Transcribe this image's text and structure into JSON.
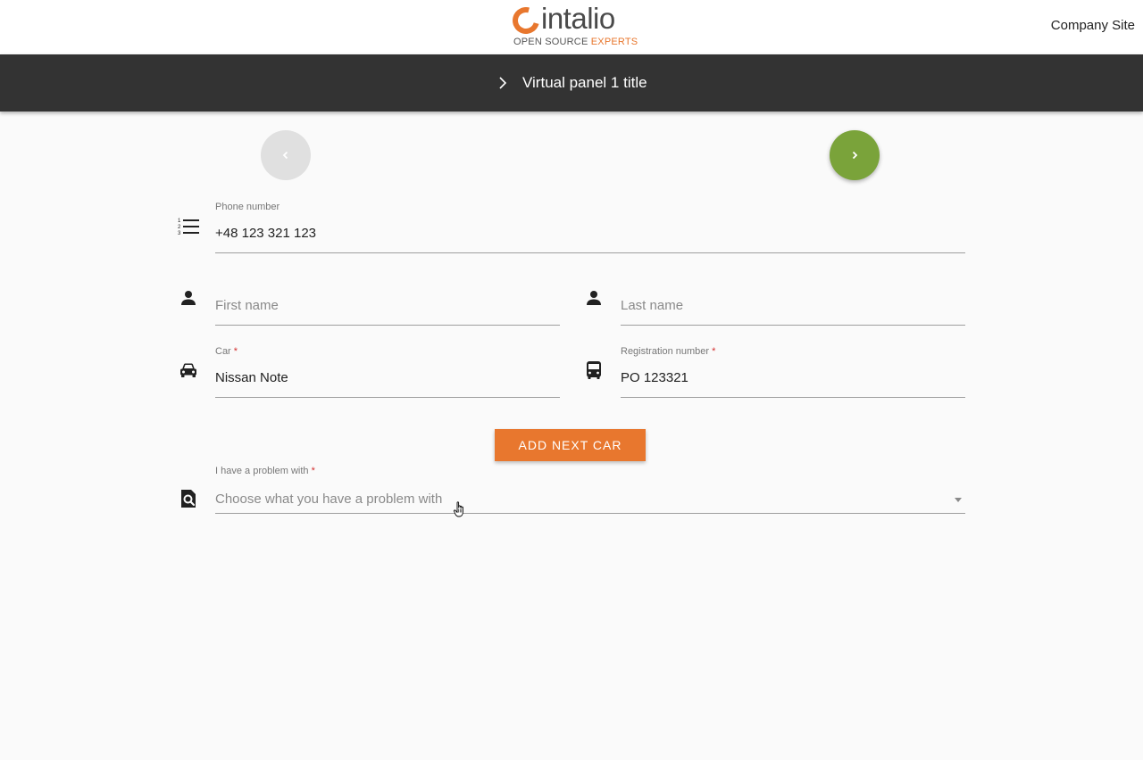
{
  "brand": {
    "name": "intalio",
    "tagline_prefix": "OPEN SOURCE ",
    "tagline_accent": "EXPERTS",
    "accent_color": "#e8772e"
  },
  "header": {
    "company_link": "Company Site"
  },
  "titlebar": {
    "title": "Virtual panel 1 title"
  },
  "nav": {
    "prev_icon": "chevron-left-icon",
    "next_icon": "chevron-right-icon",
    "next_color": "#7aa33a"
  },
  "form": {
    "phone": {
      "label": "Phone number",
      "value": "+48 123 321 123",
      "icon": "numbered-list-icon"
    },
    "first_name": {
      "placeholder": "First name",
      "icon": "person-icon"
    },
    "last_name": {
      "placeholder": "Last name",
      "icon": "person-icon"
    },
    "car": {
      "label": "Car",
      "required_mark": "*",
      "value": "Nissan Note",
      "icon": "car-icon"
    },
    "registration": {
      "label": "Registration number",
      "required_mark": "*",
      "value": "PO 123321",
      "icon": "bus-icon"
    },
    "add_button": "ADD NEXT CAR",
    "problem": {
      "label": "I have a problem with",
      "required_mark": "*",
      "placeholder": "Choose what you have a problem with",
      "icon": "find-in-page-icon"
    }
  }
}
